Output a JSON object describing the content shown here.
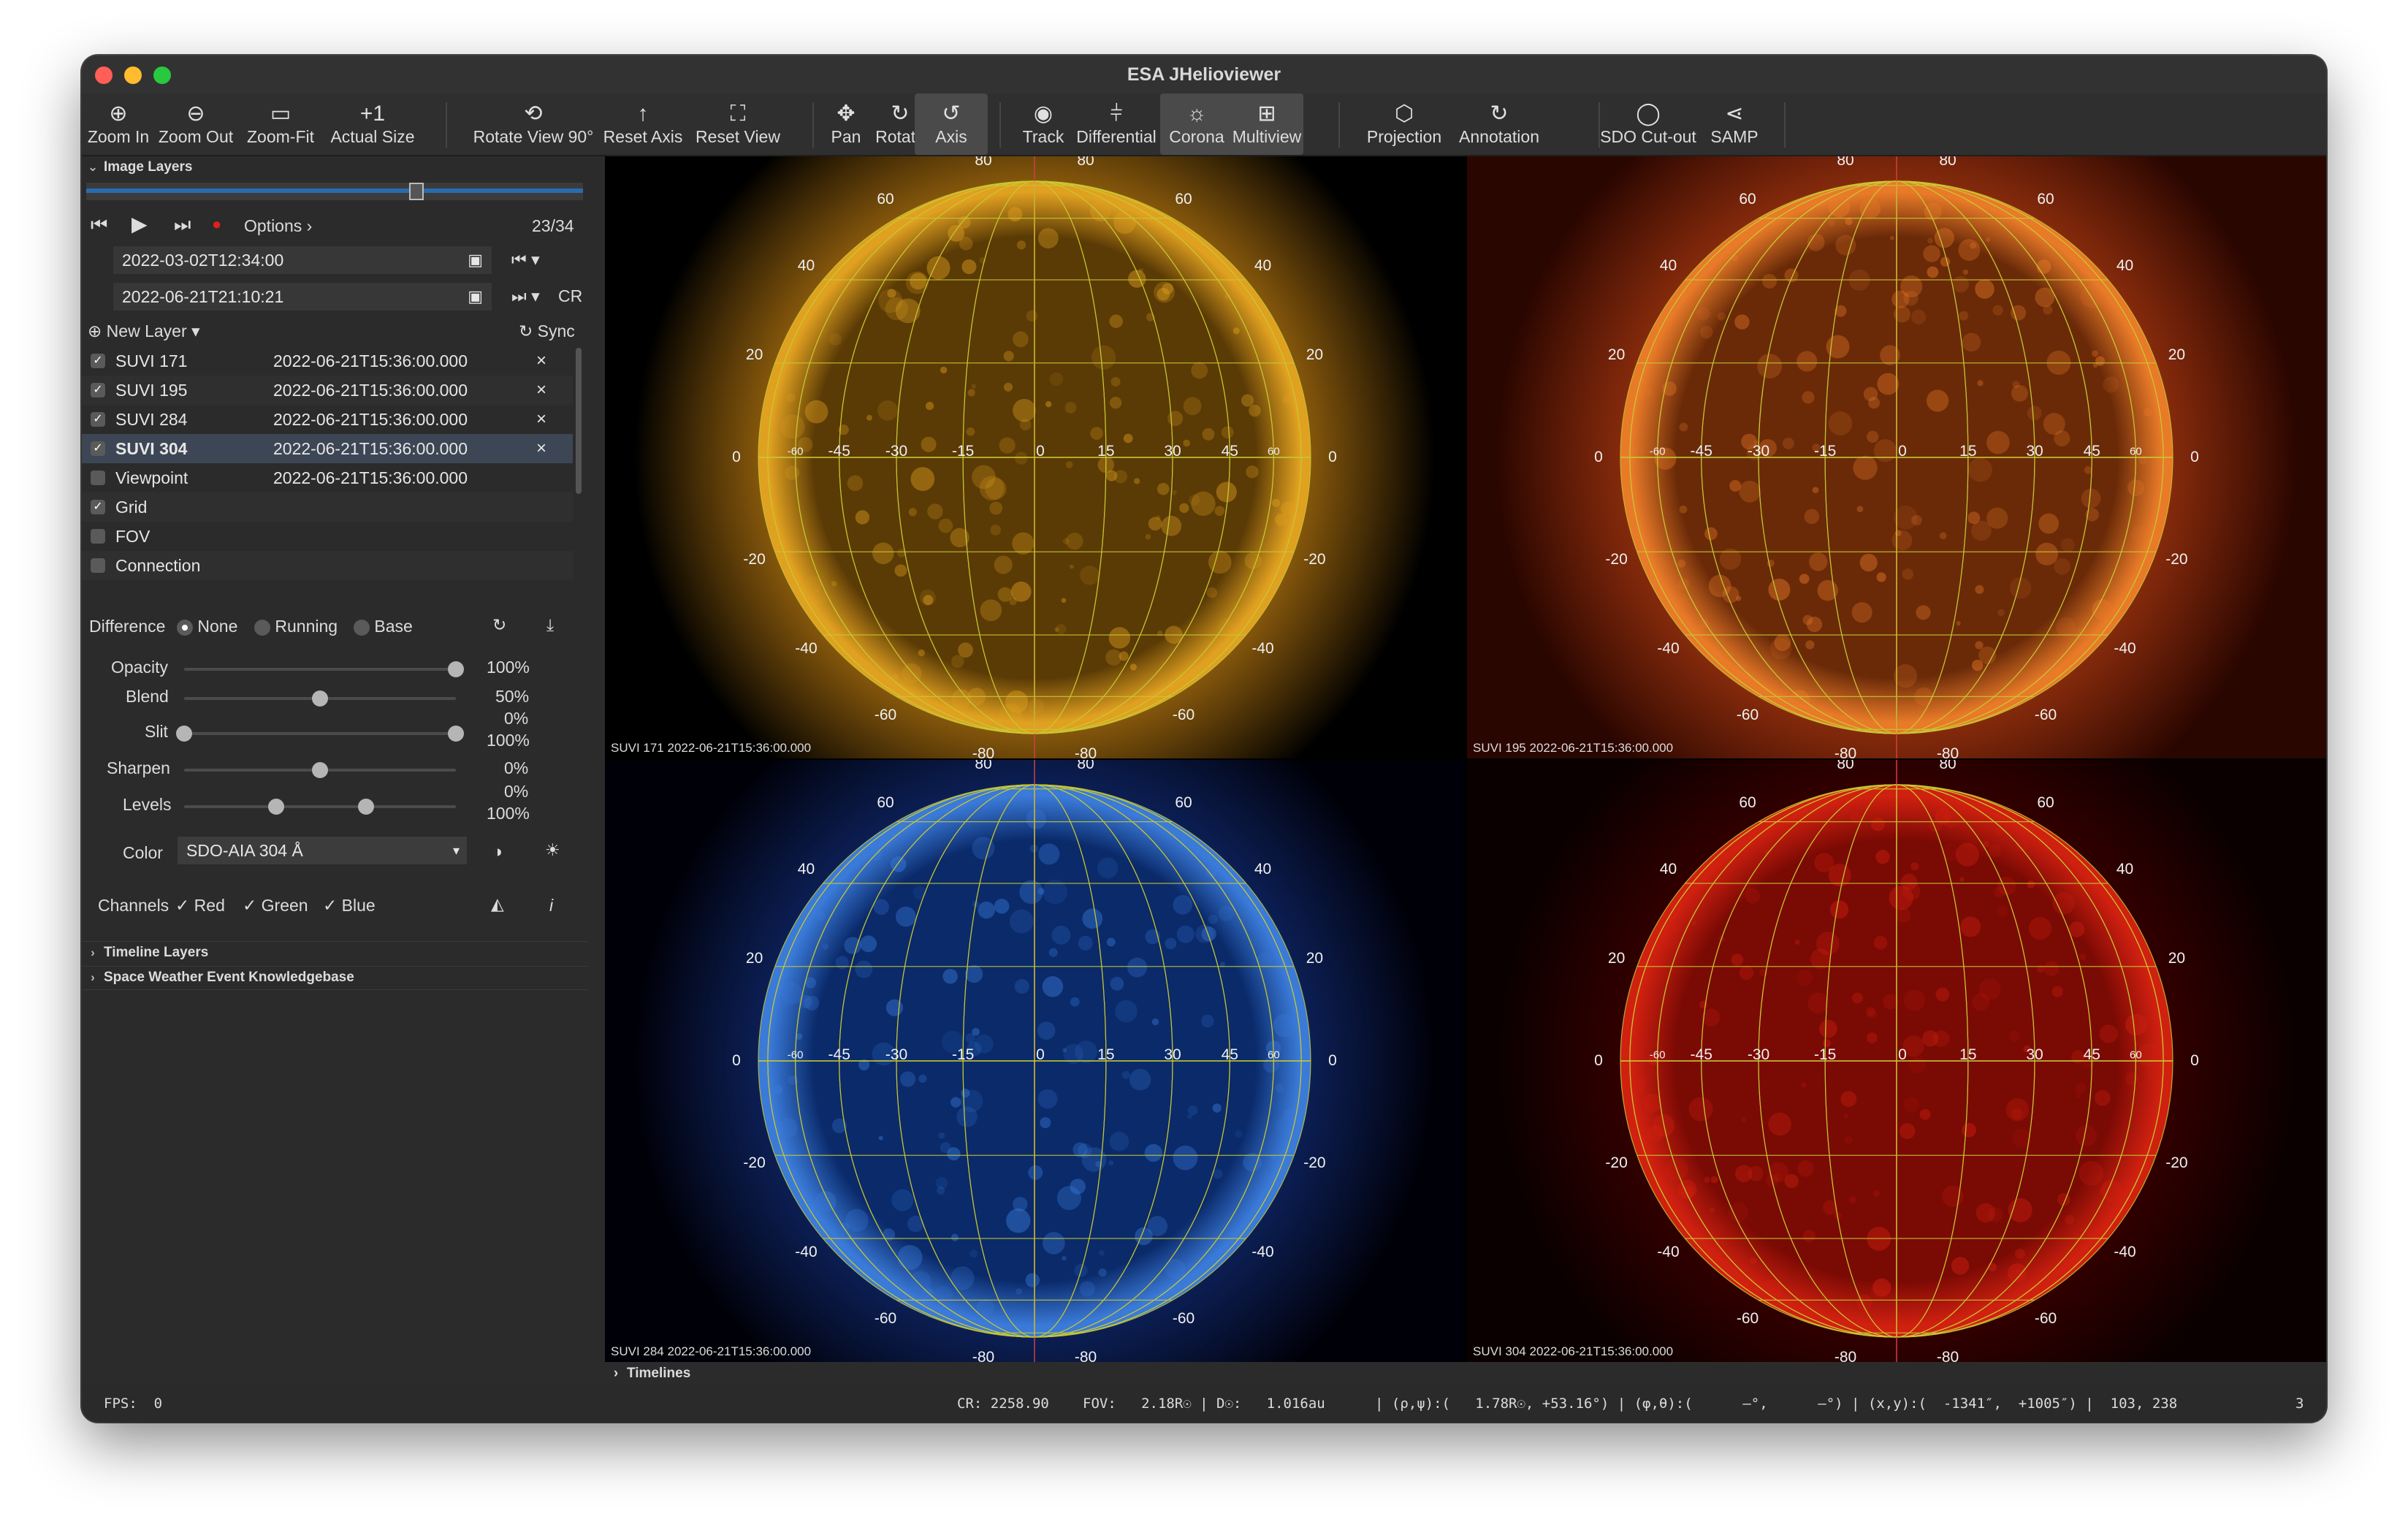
{
  "window": {
    "title": "ESA JHelioviewer"
  },
  "toolbar": [
    {
      "label": "Zoom In",
      "icon": "zoom-in-icon",
      "glyph": "⊕"
    },
    {
      "label": "Zoom Out",
      "icon": "zoom-out-icon",
      "glyph": "⊖"
    },
    {
      "label": "Zoom-Fit",
      "icon": "zoom-fit-icon",
      "glyph": "▭"
    },
    {
      "label": "Actual Size",
      "icon": "actual-size-icon",
      "glyph": "+1"
    },
    {
      "label": "Rotate View 90°",
      "icon": "rotate-view-icon",
      "glyph": "⟲"
    },
    {
      "label": "Reset Axis",
      "icon": "reset-axis-icon",
      "glyph": "↑"
    },
    {
      "label": "Reset View",
      "icon": "reset-view-icon",
      "glyph": "⛶"
    },
    {
      "label": "Pan",
      "icon": "pan-icon",
      "glyph": "✥"
    },
    {
      "label": "Rotate",
      "icon": "rotate-icon",
      "glyph": "↻"
    },
    {
      "label": "Axis",
      "icon": "axis-icon",
      "glyph": "↺"
    },
    {
      "label": "Track",
      "icon": "track-icon",
      "glyph": "◉"
    },
    {
      "label": "Differential",
      "icon": "differential-icon",
      "glyph": "⫩"
    },
    {
      "label": "Corona",
      "icon": "corona-icon",
      "glyph": "☼"
    },
    {
      "label": "Multiview",
      "icon": "multiview-icon",
      "glyph": "⊞"
    },
    {
      "label": "Projection",
      "icon": "projection-icon",
      "glyph": "⬡"
    },
    {
      "label": "Annotation",
      "icon": "annotation-icon",
      "glyph": "↻"
    },
    {
      "label": "SDO Cut-out",
      "icon": "sdo-cutout-icon",
      "glyph": "◯"
    },
    {
      "label": "SAMP",
      "icon": "samp-icon",
      "glyph": "⋖"
    }
  ],
  "left": {
    "image_layers_title": "Image Layers",
    "options_label": "Options",
    "frame_counter": "23/34",
    "start_time": "2022-03-02T12:34:00",
    "end_time": "2022-06-21T21:10:21",
    "cr_label": "CR",
    "new_layer_label": "New Layer",
    "sync_label": "Sync",
    "layers": [
      {
        "name": "SUVI 171",
        "time": "2022-06-21T15:36:00.000",
        "checked": true,
        "selected": false,
        "closable": true
      },
      {
        "name": "SUVI 195",
        "time": "2022-06-21T15:36:00.000",
        "checked": true,
        "selected": false,
        "closable": true
      },
      {
        "name": "SUVI 284",
        "time": "2022-06-21T15:36:00.000",
        "checked": true,
        "selected": false,
        "closable": true
      },
      {
        "name": "SUVI 304",
        "time": "2022-06-21T15:36:00.000",
        "checked": true,
        "selected": true,
        "closable": true
      },
      {
        "name": "Viewpoint",
        "time": "2022-06-21T15:36:00.000",
        "checked": false,
        "selected": false,
        "closable": false
      },
      {
        "name": "Grid",
        "time": "",
        "checked": true,
        "selected": false,
        "closable": false
      },
      {
        "name": "FOV",
        "time": "",
        "checked": false,
        "selected": false,
        "closable": false
      },
      {
        "name": "Connection",
        "time": "",
        "checked": false,
        "selected": false,
        "closable": false
      }
    ],
    "difference": {
      "label": "Difference",
      "options": [
        "None",
        "Running",
        "Base"
      ],
      "selected": "None"
    },
    "opacity": {
      "label": "Opacity",
      "value": "100%",
      "fraction": 1.0
    },
    "blend": {
      "label": "Blend",
      "value": "50%",
      "fraction": 0.5
    },
    "slit": {
      "label": "Slit",
      "low": "0%",
      "high": "100%",
      "low_fraction": 0.0,
      "high_fraction": 1.0
    },
    "sharpen": {
      "label": "Sharpen",
      "value": "0%",
      "fraction": 0.5
    },
    "levels": {
      "label": "Levels",
      "low": "0%",
      "high": "100%",
      "low_fraction": 0.34,
      "high_fraction": 0.67
    },
    "color": {
      "label": "Color",
      "value": "SDO-AIA 304 Å"
    },
    "channels": {
      "label": "Channels",
      "items": [
        "Red",
        "Green",
        "Blue"
      ]
    },
    "timeline_layers_title": "Timeline Layers",
    "swek_title": "Space Weather Event Knowledgebase"
  },
  "panels": [
    {
      "label": "SUVI 171 2022-06-21T15:36:00.000",
      "colors": {
        "core": "#5a3a05",
        "limb": "#e0a020",
        "glow": "#b87810",
        "bg": "#000000"
      }
    },
    {
      "label": "SUVI 195 2022-06-21T15:36:00.000",
      "colors": {
        "core": "#6a2a08",
        "limb": "#e87a28",
        "glow": "#a83810",
        "bg": "#2a0600"
      }
    },
    {
      "label": "SUVI 284 2022-06-21T15:36:00.000",
      "colors": {
        "core": "#0a2a6a",
        "limb": "#3a7ad8",
        "glow": "#102a70",
        "bg": "#000008"
      }
    },
    {
      "label": "SUVI 304 2022-06-21T15:36:00.000",
      "colors": {
        "core": "#7a0a04",
        "limb": "#d02010",
        "glow": "#400000",
        "bg": "#0a0000"
      }
    }
  ],
  "grid": {
    "lat_labels": [
      "80",
      "60",
      "40",
      "20",
      "0",
      "-20",
      "-40",
      "-60",
      "-80"
    ],
    "lon_labels": [
      "-60",
      "-45",
      "-30",
      "-15",
      "0",
      "15",
      "30",
      "45",
      "60"
    ]
  },
  "timelines_title": "Timelines",
  "status": {
    "fps": "FPS:  0",
    "cr": "CR: 2258.90",
    "fov": "FOV:   2.18R☉ | D☉:   1.016au",
    "polar": "| (ρ,ψ):(   1.78R☉, +53.16°) | (φ,θ):(      –°,      –°) | (x,y):(  -1341″,  +1005″) |  103, 238",
    "count": "3"
  }
}
